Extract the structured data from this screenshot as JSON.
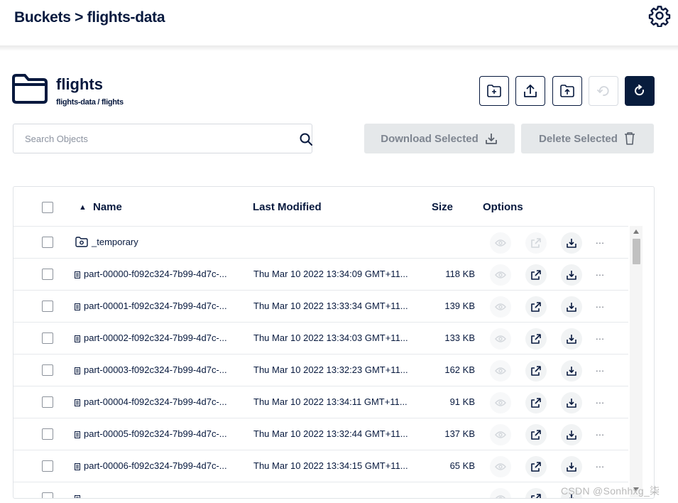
{
  "header": {
    "breadcrumb": "Buckets > flights-data",
    "settings_icon": "gear-icon"
  },
  "folder": {
    "name": "flights",
    "path": "flights-data / flights",
    "icon": "folder-icon"
  },
  "toolbar": {
    "buttons": [
      {
        "name": "create-folder-button",
        "icon": "folder-plus-icon",
        "disabled": false
      },
      {
        "name": "upload-file-button",
        "icon": "upload-icon",
        "disabled": false
      },
      {
        "name": "upload-folder-button",
        "icon": "folder-upload-icon",
        "disabled": false
      },
      {
        "name": "rewind-button",
        "icon": "rewind-icon",
        "disabled": true
      },
      {
        "name": "refresh-button",
        "icon": "refresh-icon",
        "disabled": false
      }
    ]
  },
  "search": {
    "placeholder": "Search Objects",
    "value": ""
  },
  "actions": {
    "download_label": "Download Selected",
    "delete_label": "Delete Selected"
  },
  "table": {
    "headers": {
      "name": "Name",
      "sort_indicator": "▲",
      "last_modified": "Last Modified",
      "size": "Size",
      "options": "Options"
    },
    "rows": [
      {
        "type": "folder",
        "name": "_temporary",
        "modified": "",
        "size": "",
        "preview_enabled": false,
        "share_enabled": false
      },
      {
        "type": "file",
        "name": "part-00000-f092c324-7b99-4d7c-...",
        "modified": "Thu Mar 10 2022 13:34:09 GMT+11...",
        "size": "118 KB",
        "preview_enabled": false,
        "share_enabled": true
      },
      {
        "type": "file",
        "name": "part-00001-f092c324-7b99-4d7c-...",
        "modified": "Thu Mar 10 2022 13:33:34 GMT+11...",
        "size": "139 KB",
        "preview_enabled": false,
        "share_enabled": true
      },
      {
        "type": "file",
        "name": "part-00002-f092c324-7b99-4d7c-...",
        "modified": "Thu Mar 10 2022 13:34:03 GMT+11...",
        "size": "133 KB",
        "preview_enabled": false,
        "share_enabled": true
      },
      {
        "type": "file",
        "name": "part-00003-f092c324-7b99-4d7c-...",
        "modified": "Thu Mar 10 2022 13:32:23 GMT+11...",
        "size": "162 KB",
        "preview_enabled": false,
        "share_enabled": true
      },
      {
        "type": "file",
        "name": "part-00004-f092c324-7b99-4d7c-...",
        "modified": "Thu Mar 10 2022 13:34:11 GMT+11...",
        "size": "91 KB",
        "preview_enabled": false,
        "share_enabled": true
      },
      {
        "type": "file",
        "name": "part-00005-f092c324-7b99-4d7c-...",
        "modified": "Thu Mar 10 2022 13:32:44 GMT+11...",
        "size": "137 KB",
        "preview_enabled": false,
        "share_enabled": true
      },
      {
        "type": "file",
        "name": "part-00006-f092c324-7b99-4d7c-...",
        "modified": "Thu Mar 10 2022 13:34:15 GMT+11...",
        "size": "65 KB",
        "preview_enabled": false,
        "share_enabled": true
      },
      {
        "type": "file",
        "name": "",
        "modified": "",
        "size": "",
        "preview_enabled": false,
        "share_enabled": true
      }
    ],
    "more_label": "..."
  },
  "watermark": "CSDN @Sonhhxg_柒",
  "colors": {
    "navy": "#07193e",
    "dark_button": "#081c3d",
    "disabled_button_bg": "#e5e8ea",
    "disabled_text": "#7e8590"
  }
}
